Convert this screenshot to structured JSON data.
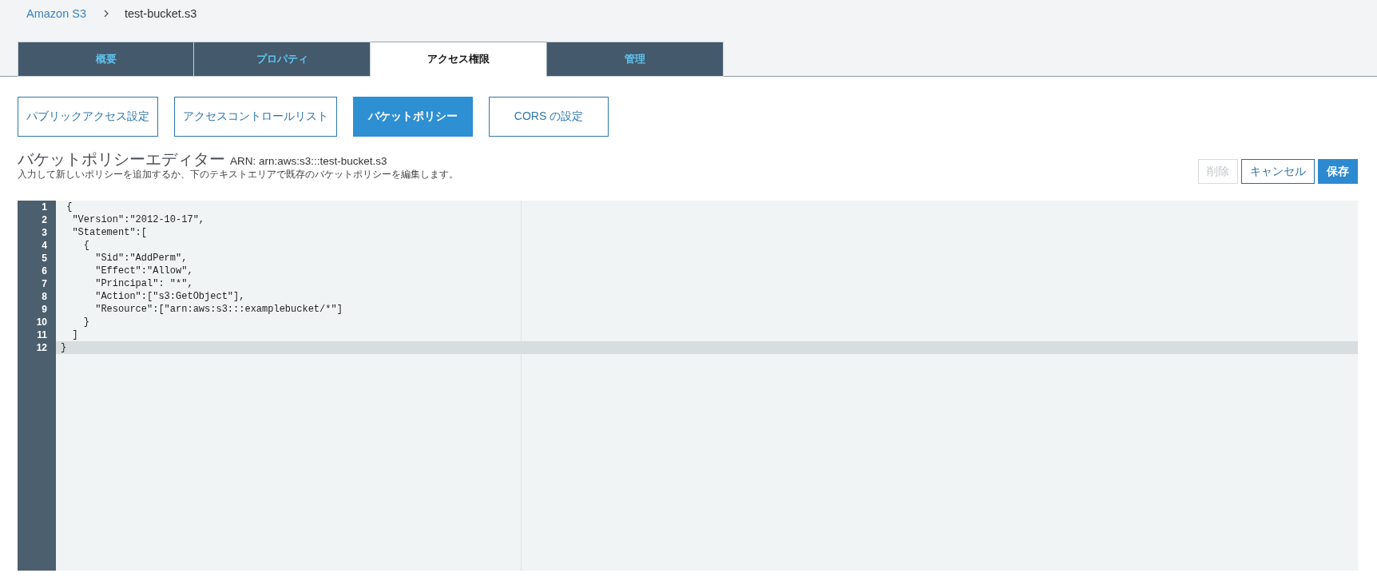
{
  "breadcrumb": {
    "items": [
      {
        "label": "Amazon S3",
        "kind": "link"
      },
      {
        "label": "test-bucket.s3",
        "kind": "current"
      }
    ]
  },
  "tabs": [
    {
      "label": "概要",
      "selected": false
    },
    {
      "label": "プロパティ",
      "selected": false
    },
    {
      "label": "アクセス権限",
      "selected": true
    },
    {
      "label": "管理",
      "selected": false
    }
  ],
  "subtabs": [
    {
      "label": "パブリックアクセス設定",
      "selected": false
    },
    {
      "label": "アクセスコントロールリスト",
      "selected": false
    },
    {
      "label": "バケットポリシー",
      "selected": true
    },
    {
      "label": "CORS の設定",
      "selected": false
    }
  ],
  "policy_editor": {
    "title": "バケットポリシーエディター",
    "arn": "ARN: arn:aws:s3:::test-bucket.s3",
    "description": "入力して新しいポリシーを追加するか、下のテキストエリアで既存のバケットポリシーを編集します。",
    "buttons": [
      {
        "label": "削除",
        "kind": "default",
        "disabled": true
      },
      {
        "label": "キャンセル",
        "kind": "default",
        "disabled": false
      },
      {
        "label": "保存",
        "kind": "primary",
        "disabled": false
      }
    ],
    "lines": [
      {
        "number": "1",
        "text": " {",
        "active": false
      },
      {
        "number": "2",
        "text": "  \"Version\":\"2012-10-17\",",
        "active": false
      },
      {
        "number": "3",
        "text": "  \"Statement\":[",
        "active": false
      },
      {
        "number": "4",
        "text": "    {",
        "active": false
      },
      {
        "number": "5",
        "text": "      \"Sid\":\"AddPerm\",",
        "active": false
      },
      {
        "number": "6",
        "text": "      \"Effect\":\"Allow\",",
        "active": false
      },
      {
        "number": "7",
        "text": "      \"Principal\": \"*\",",
        "active": false
      },
      {
        "number": "8",
        "text": "      \"Action\":[\"s3:GetObject\"],",
        "active": false
      },
      {
        "number": "9",
        "text": "      \"Resource\":[\"arn:aws:s3:::examplebucket/*\"]",
        "active": false
      },
      {
        "number": "10",
        "text": "    }",
        "active": false
      },
      {
        "number": "11",
        "text": "  ]",
        "active": false
      },
      {
        "number": "12",
        "text": "}",
        "active": true
      }
    ]
  }
}
